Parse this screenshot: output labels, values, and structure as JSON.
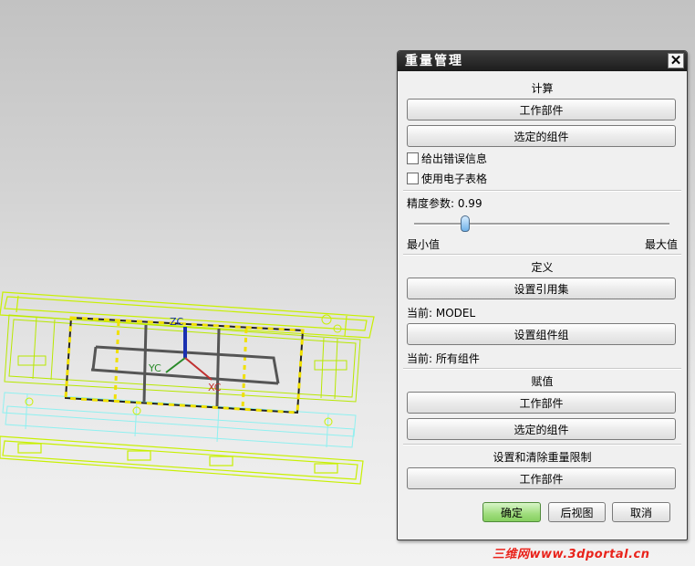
{
  "dialog": {
    "title": "重量管理",
    "close_glyph": "✕",
    "calc_label": "计算",
    "calc_work_part": "工作部件",
    "calc_selected": "选定的组件",
    "check_errors": "给出错误信息",
    "check_spreadsheet": "使用电子表格",
    "precision_label": "精度参数: 0.99",
    "precision_value": 0.99,
    "slider_min": "最小值",
    "slider_max": "最大值",
    "define_label": "定义",
    "set_ref_set": "设置引用集",
    "current_model": "当前: MODEL",
    "set_comp_group": "设置组件组",
    "current_all": "当前: 所有组件",
    "assign_label": "赋值",
    "assign_work_part": "工作部件",
    "assign_selected": "选定的组件",
    "limit_label": "设置和清除重量限制",
    "limit_work_part": "工作部件",
    "ok": "确定",
    "back_view": "后视图",
    "cancel": "取消"
  },
  "viewport": {
    "axis_z": "ZC",
    "axis_y": "YC",
    "axis_x": "XC"
  },
  "watermark": "三维网www.3dportal.cn",
  "colors": {
    "model_wire": "#c8f000",
    "model_outline": "#9ad000",
    "cyan_wire": "#8ff0f0",
    "accent_green": "#86cf60",
    "watermark_red": "#e8231b"
  }
}
